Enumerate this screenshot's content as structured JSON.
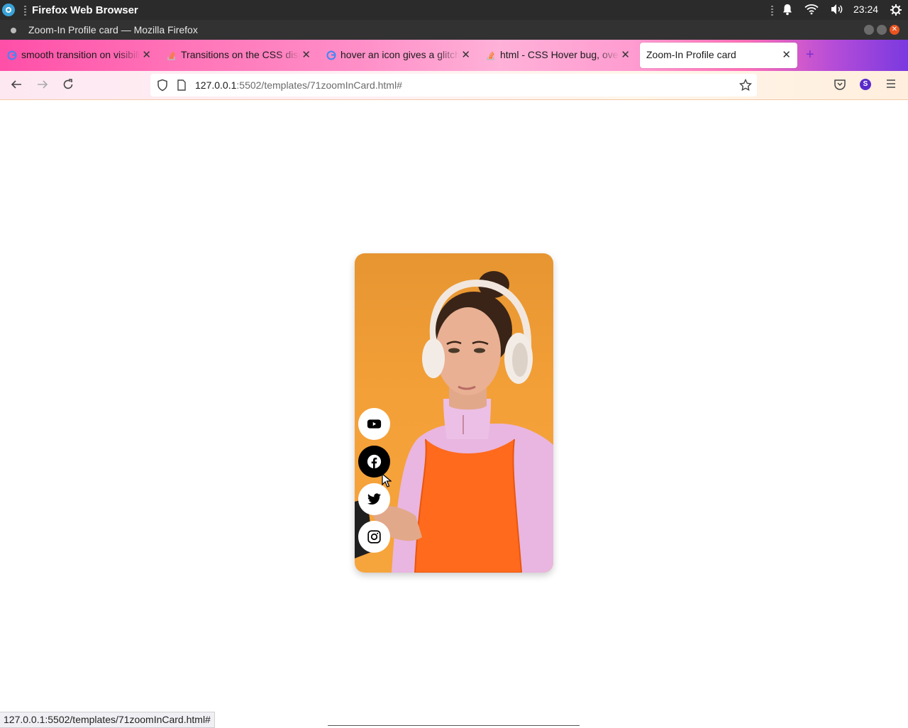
{
  "os": {
    "app_name": "Firefox Web Browser",
    "time": "23:24"
  },
  "window": {
    "title": "Zoom-In Profile card — Mozilla Firefox"
  },
  "tabs": [
    {
      "label": "smooth transition on visibility",
      "favicon": "google-icon"
    },
    {
      "label": "Transitions on the CSS display",
      "favicon": "stackoverflow-icon"
    },
    {
      "label": "hover an icon gives a glitch",
      "favicon": "google-icon"
    },
    {
      "label": "html - CSS Hover bug, over",
      "favicon": "stackoverflow-icon"
    },
    {
      "label": "Zoom-In Profile card",
      "active": true
    }
  ],
  "urlbar": {
    "host": "127.0.0.1",
    "rest": ":5502/templates/71zoomInCard.html#"
  },
  "account": {
    "initial": "S"
  },
  "card": {
    "image": "profile-photo-woman-headphones",
    "socials": [
      {
        "name": "youtube",
        "icon": "youtube-icon",
        "hovered": false
      },
      {
        "name": "facebook",
        "icon": "facebook-icon",
        "hovered": true
      },
      {
        "name": "twitter",
        "icon": "twitter-icon",
        "hovered": false
      },
      {
        "name": "instagram",
        "icon": "instagram-icon",
        "hovered": false
      }
    ]
  },
  "status_bar": {
    "url": "127.0.0.1:5502/templates/71zoomInCard.html#"
  },
  "colors": {
    "accent": "#ff4fa8",
    "card_bg": "#f4a038",
    "sweater": "#ff6a1c",
    "sleeve": "#e8b6e0"
  }
}
